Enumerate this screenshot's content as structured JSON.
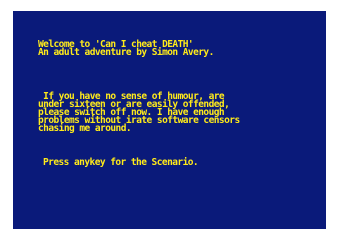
{
  "screen": {
    "intro_lines": [
      "Welcome to 'Can I cheat DEATH'",
      "An adult adventure by Simon Avery."
    ],
    "warning_lines": [
      " If you have no sense of humour, are",
      "under sixteen or are easily offended,",
      "please switch off now. I have enough",
      "problems without irate software censors",
      "chasing me around."
    ],
    "prompt": "Press anykey for the Scenario."
  },
  "colors": {
    "background": "#0a1a7a",
    "text": "#ffeb1a",
    "border": "#ffffff"
  }
}
